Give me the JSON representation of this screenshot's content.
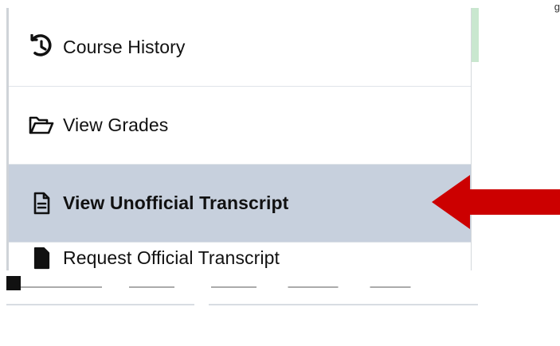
{
  "top_right": {
    "text": "g"
  },
  "menu": {
    "items": [
      {
        "label": "Course History",
        "icon": "history-icon",
        "selected": false
      },
      {
        "label": "View Grades",
        "icon": "folder-open-icon",
        "selected": false
      },
      {
        "label": "View Unofficial Transcript",
        "icon": "document-icon",
        "selected": true
      },
      {
        "label": "Request Official Transcript",
        "icon": "document-icon",
        "selected": false
      }
    ]
  },
  "colors": {
    "selected_bg": "#c7d0dd",
    "arrow": "#cc0000",
    "panel_border": "#cfd3d8",
    "green_strip": "#c9e7cf"
  }
}
